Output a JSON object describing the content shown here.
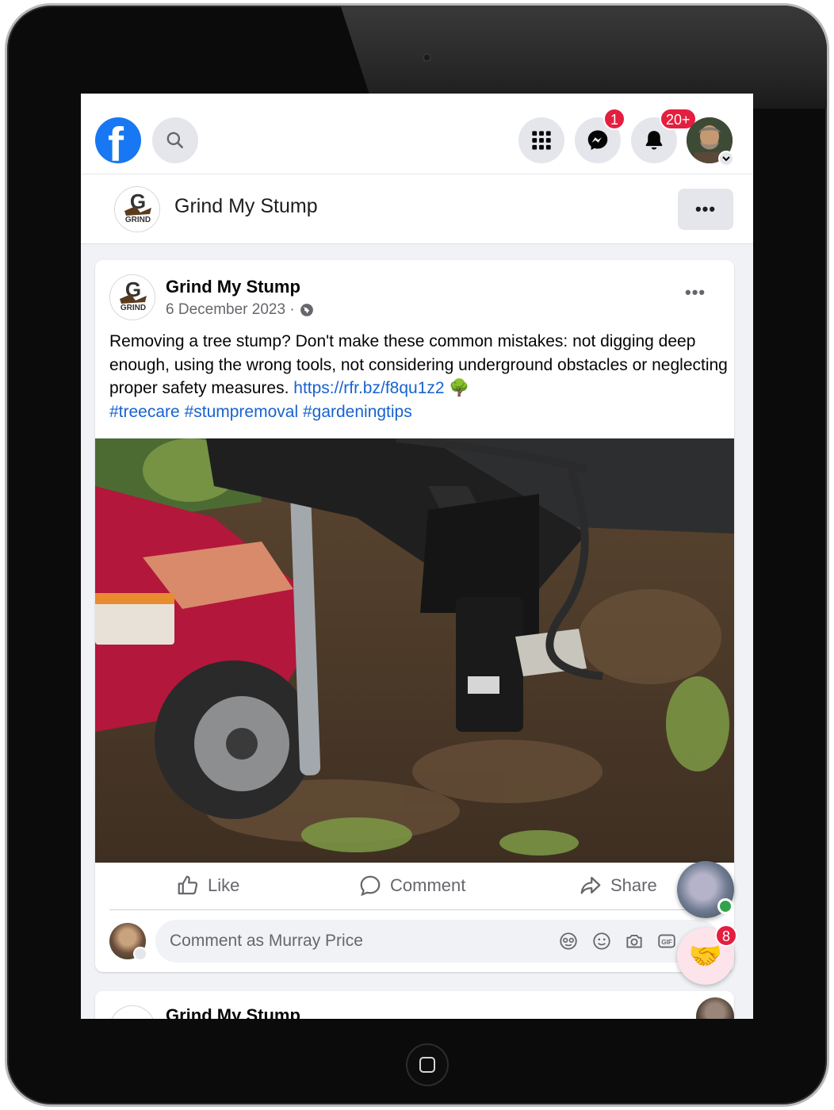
{
  "topbar": {
    "logo": "facebook-logo",
    "messenger_badge": "1",
    "notifications_badge": "20+"
  },
  "page_header": {
    "title": "Grind My Stump",
    "more": "•••"
  },
  "post": {
    "author": "Grind My Stump",
    "date": "6 December 2023 ·",
    "more": "•••",
    "text": "Removing a tree stump? Don't make these common mistakes: not digging deep enough, using the wrong tools, not considering underground obstacles or neglecting proper safety measures.",
    "link": "https://rfr.bz/f8qu1z2",
    "emoji": "🌳",
    "hashtags": [
      "#treecare",
      "#stumpremoval",
      "#gardeningtips"
    ],
    "actions": {
      "like": "Like",
      "comment": "Comment",
      "share": "Share"
    },
    "comment_placeholder": "Comment as Murray Price"
  },
  "next_post": {
    "author": "Grind My Stump"
  },
  "chat_heads": {
    "badge": "8",
    "emoji": "🤝"
  },
  "colors": {
    "facebook_blue": "#1877f2",
    "badge_red": "#e41e3f",
    "link_blue": "#1763cf",
    "online_green": "#31a24c"
  }
}
